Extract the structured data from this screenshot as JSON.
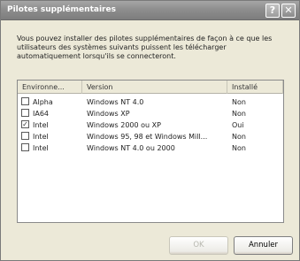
{
  "window": {
    "title": "Pilotes supplémentaires"
  },
  "intro": "Vous pouvez installer des pilotes supplémentaires de façon à ce que les utilisateurs des systèmes suivants puissent les télécharger automatiquement lorsqu'ils se connecteront.",
  "table": {
    "columns": [
      "Environne...",
      "Version",
      "Installé"
    ],
    "rows": [
      {
        "checked": false,
        "env": "Alpha",
        "version": "Windows NT 4.0",
        "installed": "Non"
      },
      {
        "checked": false,
        "env": "IA64",
        "version": "Windows XP",
        "installed": "Non"
      },
      {
        "checked": true,
        "env": "Intel",
        "version": "Windows 2000 ou XP",
        "installed": "Oui"
      },
      {
        "checked": false,
        "env": "Intel",
        "version": "Windows 95, 98 et Windows Mill...",
        "installed": "Non"
      },
      {
        "checked": false,
        "env": "Intel",
        "version": "Windows NT 4.0 ou 2000",
        "installed": "Non"
      }
    ]
  },
  "buttons": {
    "ok": "OK",
    "cancel": "Annuler"
  },
  "icons": {
    "help": "question-mark",
    "close": "x"
  }
}
